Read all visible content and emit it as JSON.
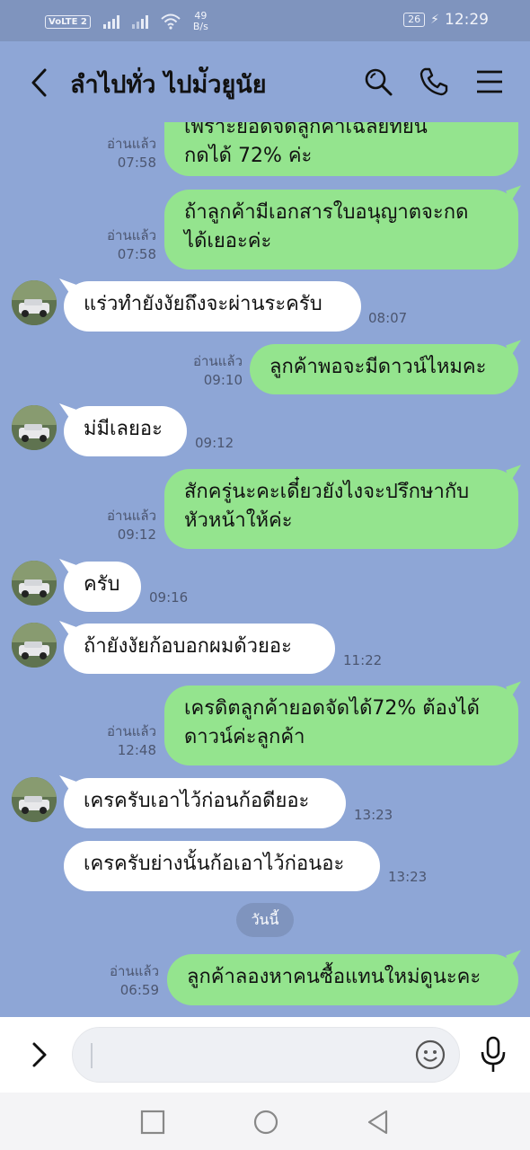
{
  "status_bar": {
    "volte": "VoLTE",
    "sim": "2",
    "net_speed_value": "49",
    "net_speed_unit": "B/s",
    "battery": "26",
    "time": "12:29"
  },
  "header": {
    "title": "ลำไปทั่ว ไปม่ัวยูนัย",
    "icons": [
      "back-icon",
      "search-icon",
      "phone-icon",
      "menu-icon"
    ]
  },
  "messages": [
    {
      "side": "out",
      "lines": [
        "เพราะยอดจัดลูกค้าเฉลี่ยที่ยื่น",
        "กดได้ 72% ค่ะ"
      ],
      "read": "อ่านแล้ว",
      "time": "07:58"
    },
    {
      "side": "out",
      "lines": [
        "ถ้าลูกค้ามีเอกสารใบอนุญาตจะกด",
        "ได้เยอะค่ะ"
      ],
      "read": "อ่านแล้ว",
      "time": "07:58"
    },
    {
      "side": "in",
      "lines": [
        "แร่วทำยังงัยถึงจะผ่านระครับ"
      ],
      "time": "08:07"
    },
    {
      "side": "out",
      "lines": [
        "ลูกค้าพอจะมีดาวน์ไหมคะ"
      ],
      "read": "อ่านแล้ว",
      "time": "09:10"
    },
    {
      "side": "in",
      "lines": [
        "ม่มีเลยอะ"
      ],
      "time": "09:12"
    },
    {
      "side": "out",
      "lines": [
        "สักครู่นะคะเดี๋ยวยังไงจะปรึกษากับ",
        "หัวหน้าให้ค่ะ"
      ],
      "read": "อ่านแล้ว",
      "time": "09:12"
    },
    {
      "side": "in",
      "lines": [
        "ครับ"
      ],
      "time": "09:16"
    },
    {
      "side": "in",
      "lines": [
        "ถ้ายังงัยก้อบอกผมด้วยอะ"
      ],
      "time": "11:22"
    },
    {
      "side": "out",
      "lines": [
        "เครดิตลูกค้ายอดจัดได้72% ต้องได้",
        "ดาวน์ค่ะลูกค้า"
      ],
      "read": "อ่านแล้ว",
      "time": "12:48"
    },
    {
      "side": "in",
      "lines": [
        "เครครับเอาไว้ก่อนก้อดียอะ"
      ],
      "time": "13:23"
    },
    {
      "side": "in",
      "lines": [
        "เครครับย่างนั้นก้อเอาไว้ก่อนอะ"
      ],
      "time": "13:23"
    },
    {
      "side": "out",
      "lines": [
        "ลูกค้าลองหาคนซื้อแทนใหม่ดูนะคะ"
      ],
      "read": "อ่านแล้ว",
      "time": "06:59"
    }
  ],
  "date_separator": "วันนี้",
  "input": {
    "placeholder": "",
    "icons": [
      "expand-icon",
      "emoji-icon",
      "microphone-icon"
    ]
  },
  "nav": {
    "icons": [
      "recent-apps-icon",
      "home-icon",
      "back-nav-icon"
    ]
  },
  "colors": {
    "chat_bg": "#8ea6d6",
    "outgoing_bubble": "#94e48e",
    "incoming_bubble": "#ffffff",
    "status_bar": "#7f94be"
  }
}
